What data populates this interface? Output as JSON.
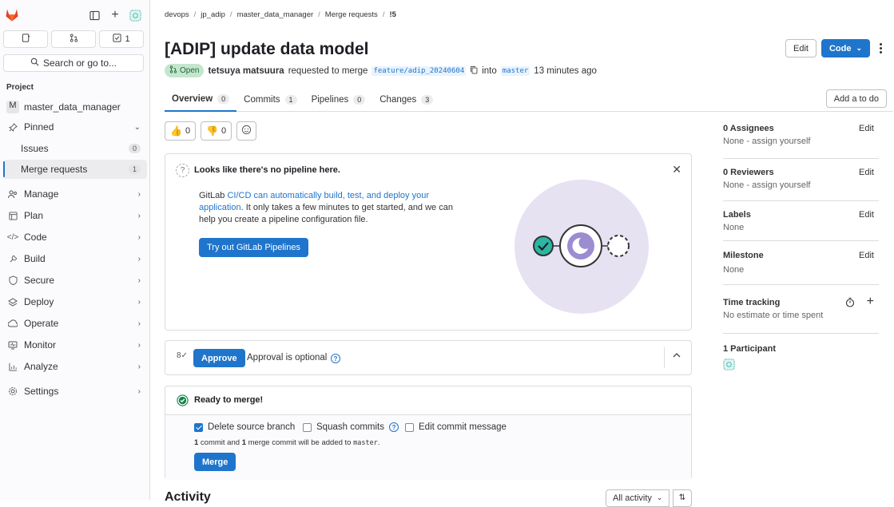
{
  "sidebar": {
    "todo_count": "1",
    "search_label": "Search or go to...",
    "section_label": "Project",
    "project_initial": "M",
    "project_name": "master_data_manager",
    "pinned_label": "Pinned",
    "issues_label": "Issues",
    "issues_count": "0",
    "mr_label": "Merge requests",
    "mr_count": "1",
    "items": [
      {
        "label": "Manage",
        "icon": "manage-icon"
      },
      {
        "label": "Plan",
        "icon": "plan-icon"
      },
      {
        "label": "Code",
        "icon": "code-icon"
      },
      {
        "label": "Build",
        "icon": "build-icon"
      },
      {
        "label": "Secure",
        "icon": "shield-icon"
      },
      {
        "label": "Deploy",
        "icon": "deploy-icon"
      },
      {
        "label": "Operate",
        "icon": "operate-icon"
      },
      {
        "label": "Monitor",
        "icon": "monitor-icon"
      },
      {
        "label": "Analyze",
        "icon": "analyze-icon"
      }
    ],
    "settings_label": "Settings"
  },
  "breadcrumb": [
    "devops",
    "jp_adip",
    "master_data_manager",
    "Merge requests",
    "!5"
  ],
  "mr": {
    "title": "[ADIP] update data model",
    "status": "Open",
    "author": "tetsuya matsuura",
    "requested_text": "requested to merge",
    "source_branch": "feature/adip_20240604",
    "into_text": "into",
    "target_branch": "master",
    "time_ago": "13 minutes ago"
  },
  "header_buttons": {
    "edit": "Edit",
    "code": "Code"
  },
  "tabs": [
    {
      "label": "Overview",
      "count": "0"
    },
    {
      "label": "Commits",
      "count": "1"
    },
    {
      "label": "Pipelines",
      "count": "0"
    },
    {
      "label": "Changes",
      "count": "3"
    }
  ],
  "add_todo": "Add a to do",
  "reactions": {
    "thumbsup": "0",
    "thumbsdown": "0"
  },
  "pipeline_card": {
    "heading": "Looks like there's no pipeline here.",
    "body_pre": "GitLab ",
    "body_link": "CI/CD can automatically build, test, and deploy your application",
    "body_post": ". It only takes a few minutes to get started, and we can help you create a pipeline configuration file.",
    "button": "Try out GitLab Pipelines"
  },
  "approval": {
    "button": "Approve",
    "text": "Approval is optional"
  },
  "merge": {
    "status": "Ready to merge!",
    "opt_delete": "Delete source branch",
    "opt_squash": "Squash commits",
    "opt_edit": "Edit commit message",
    "note_n1": "1",
    "note_a": " commit and ",
    "note_n2": "1",
    "note_b": " merge commit will be added to ",
    "note_branch": "master",
    "note_end": ".",
    "button": "Merge"
  },
  "activity": {
    "title": "Activity",
    "filter": "All activity"
  },
  "right_sidebar": {
    "assignees_title": "0 Assignees",
    "assignees_sub": "None - assign yourself",
    "reviewers_title": "0 Reviewers",
    "reviewers_sub": "None - assign yourself",
    "labels_title": "Labels",
    "labels_sub": "None",
    "milestone_title": "Milestone",
    "milestone_sub": "None",
    "time_title": "Time tracking",
    "time_sub": "No estimate or time spent",
    "participants_title": "1 Participant",
    "edit": "Edit"
  },
  "colors": {
    "accent": "#1f75cb",
    "open_badge": "#c3e6cd",
    "illustration_bg": "#e6e2f2",
    "check_green": "#108548"
  }
}
